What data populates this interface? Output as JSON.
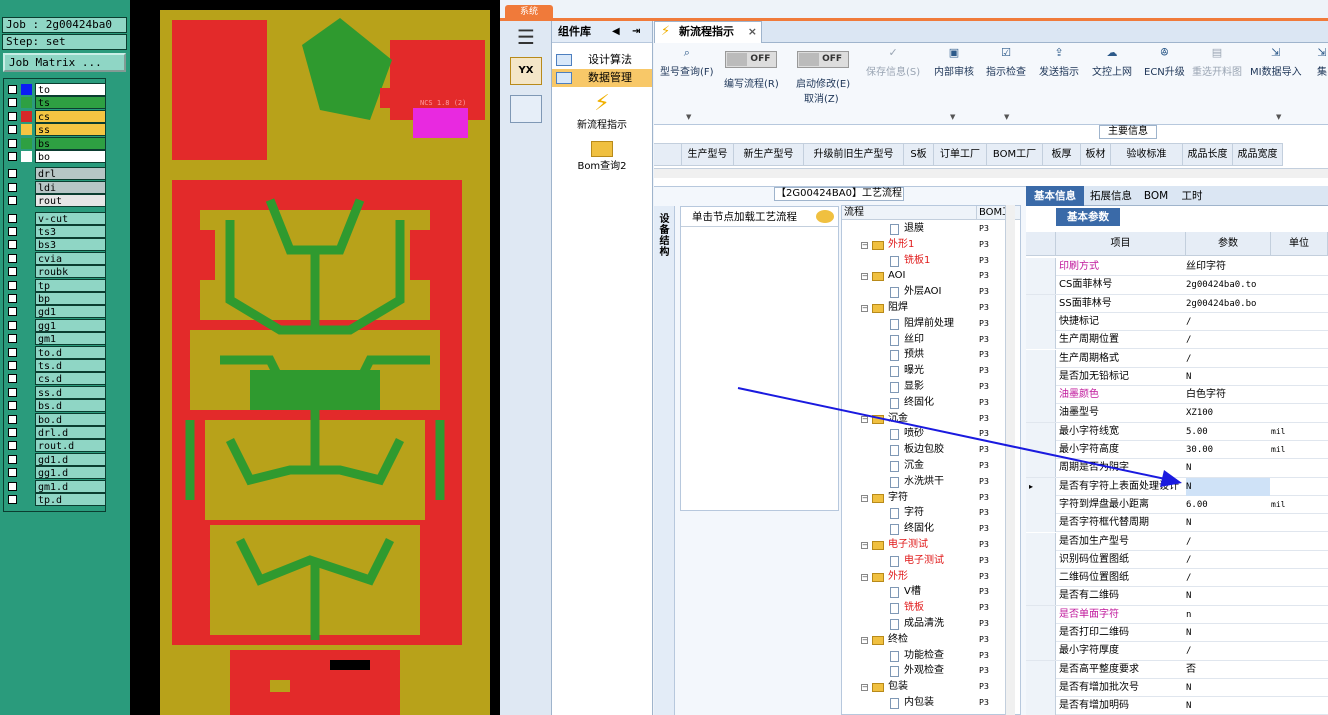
{
  "cad": {
    "job_line": "Job : 2g00424ba0",
    "step_line": "Step: set",
    "matrix_button": "Job Matrix ...",
    "layers": [
      {
        "name": "to",
        "color": "#0b1cf5",
        "type": "sig"
      },
      {
        "name": "ts",
        "color": "#2ea042",
        "type": "sig"
      },
      {
        "name": "cs",
        "color": "#d42828",
        "type": "sig"
      },
      {
        "name": "ss",
        "color": "#f4c542",
        "type": "sig"
      },
      {
        "name": "bs",
        "color": "#2ea042",
        "type": "sig"
      },
      {
        "name": "bo",
        "color": "#ffffff",
        "type": "sig"
      },
      {
        "name": "drl",
        "color": "",
        "type": "drill"
      },
      {
        "name": "ldi",
        "color": "",
        "type": "drill"
      },
      {
        "name": "rout",
        "color": "",
        "type": "drill"
      },
      {
        "name": "v-cut",
        "color": "",
        "type": "misc"
      },
      {
        "name": "ts3",
        "color": "",
        "type": "misc"
      },
      {
        "name": "bs3",
        "color": "",
        "type": "misc"
      },
      {
        "name": "cvia",
        "color": "",
        "type": "misc"
      },
      {
        "name": "roubk",
        "color": "",
        "type": "misc"
      },
      {
        "name": "tp",
        "color": "",
        "type": "misc"
      },
      {
        "name": "bp",
        "color": "",
        "type": "misc"
      },
      {
        "name": "gd1",
        "color": "",
        "type": "misc"
      },
      {
        "name": "gg1",
        "color": "",
        "type": "misc"
      },
      {
        "name": "gm1",
        "color": "",
        "type": "misc"
      },
      {
        "name": "to.d",
        "color": "",
        "type": "misc"
      },
      {
        "name": "ts.d",
        "color": "",
        "type": "misc"
      },
      {
        "name": "cs.d",
        "color": "",
        "type": "misc"
      },
      {
        "name": "ss.d",
        "color": "",
        "type": "misc"
      },
      {
        "name": "bs.d",
        "color": "",
        "type": "misc"
      },
      {
        "name": "bo.d",
        "color": "",
        "type": "misc"
      },
      {
        "name": "drl.d",
        "color": "",
        "type": "misc"
      },
      {
        "name": "rout.d",
        "color": "",
        "type": "misc"
      },
      {
        "name": "gd1.d",
        "color": "",
        "type": "misc"
      },
      {
        "name": "gg1.d",
        "color": "",
        "type": "misc"
      },
      {
        "name": "gm1.d",
        "color": "",
        "type": "misc"
      },
      {
        "name": "tp.d",
        "color": "",
        "type": "misc"
      }
    ],
    "pcb_colors": {
      "board": "#b8a21a",
      "copper": "#e32a2a",
      "trace": "#2f9a2f",
      "highlight": "#e829e0"
    },
    "pcb_label": "NCS 1.8 (2)"
  },
  "app": {
    "system_tab": "系统",
    "component_lib": {
      "title": "组件库",
      "items": [
        "设计算法",
        "数据管理"
      ],
      "tools": [
        "新流程指示",
        "Bom查询2"
      ]
    },
    "tab": {
      "label": "新流程指示",
      "close": "×"
    },
    "toolbar": {
      "query_label": "型号查询(F)",
      "edit_flow_label": "编写流程(R)",
      "edit_flow_state": "OFF",
      "auto_modify_label": "启动修改(E)",
      "auto_modify_state": "OFF",
      "cancel_label": "取消(Z)",
      "save_label": "保存信息(S)",
      "internal_audit_label": "内部审核",
      "check_label": "指示检查",
      "send_label": "发送指示",
      "upload_label": "文控上网",
      "ecn_label": "ECN升级",
      "reselect_label": "重选开料图",
      "mi_import_label": "MI数据导入",
      "more_label": "集"
    },
    "main_info": {
      "title": "主要信息",
      "columns": [
        "生产型号",
        "新生产型号",
        "升级前旧生产型号",
        "S板",
        "订单工厂",
        "BOM工厂",
        "板厚",
        "板材",
        "验收标准",
        "成品长度",
        "成品宽度"
      ]
    },
    "flow": {
      "title": "【2G00424BA0】工艺流程",
      "device_tab": "设备结构",
      "hint": "单击节点加载工艺流程",
      "col_flow": "流程",
      "col_bom": "BOM工",
      "rows": [
        {
          "label": "退膜",
          "level": 2,
          "kind": "doc",
          "red": false,
          "bom": "P3"
        },
        {
          "label": "外形1",
          "level": 1,
          "kind": "folder",
          "red": true,
          "bom": "P3"
        },
        {
          "label": "铣板1",
          "level": 2,
          "kind": "doc",
          "red": true,
          "bom": "P3"
        },
        {
          "label": "AOI",
          "level": 1,
          "kind": "folder",
          "red": false,
          "bom": "P3"
        },
        {
          "label": "外层AOI",
          "level": 2,
          "kind": "doc",
          "red": false,
          "bom": "P3"
        },
        {
          "label": "阻焊",
          "level": 1,
          "kind": "folder",
          "red": false,
          "bom": "P3"
        },
        {
          "label": "阻焊前处理",
          "level": 2,
          "kind": "doc",
          "red": false,
          "bom": "P3"
        },
        {
          "label": "丝印",
          "level": 2,
          "kind": "doc",
          "red": false,
          "bom": "P3"
        },
        {
          "label": "预烘",
          "level": 2,
          "kind": "doc",
          "red": false,
          "bom": "P3"
        },
        {
          "label": "曝光",
          "level": 2,
          "kind": "doc",
          "red": false,
          "bom": "P3"
        },
        {
          "label": "显影",
          "level": 2,
          "kind": "doc",
          "red": false,
          "bom": "P3"
        },
        {
          "label": "终固化",
          "level": 2,
          "kind": "doc",
          "red": false,
          "bom": "P3"
        },
        {
          "label": "沉金",
          "level": 1,
          "kind": "folder",
          "red": false,
          "bom": "P3"
        },
        {
          "label": "喷砂",
          "level": 2,
          "kind": "doc",
          "red": false,
          "bom": "P3"
        },
        {
          "label": "板边包胶",
          "level": 2,
          "kind": "doc",
          "red": false,
          "bom": "P3"
        },
        {
          "label": "沉金",
          "level": 2,
          "kind": "doc",
          "red": false,
          "bom": "P3"
        },
        {
          "label": "水洗烘干",
          "level": 2,
          "kind": "doc",
          "red": false,
          "bom": "P3"
        },
        {
          "label": "字符",
          "level": 1,
          "kind": "folder",
          "red": false,
          "bom": "P3"
        },
        {
          "label": "字符",
          "level": 2,
          "kind": "doc",
          "red": false,
          "bom": "P3"
        },
        {
          "label": "终固化",
          "level": 2,
          "kind": "doc",
          "red": false,
          "bom": "P3"
        },
        {
          "label": "电子测试",
          "level": 1,
          "kind": "folder",
          "red": true,
          "bom": "P3"
        },
        {
          "label": "电子测试",
          "level": 2,
          "kind": "doc",
          "red": true,
          "bom": "P3"
        },
        {
          "label": "外形",
          "level": 1,
          "kind": "folder",
          "red": true,
          "bom": "P3"
        },
        {
          "label": "V槽",
          "level": 2,
          "kind": "doc",
          "red": false,
          "bom": "P3"
        },
        {
          "label": "铣板",
          "level": 2,
          "kind": "doc",
          "red": true,
          "bom": "P3"
        },
        {
          "label": "成品清洗",
          "level": 2,
          "kind": "doc",
          "red": false,
          "bom": "P3"
        },
        {
          "label": "终检",
          "level": 1,
          "kind": "folder",
          "red": false,
          "bom": "P3"
        },
        {
          "label": "功能检查",
          "level": 2,
          "kind": "doc",
          "red": false,
          "bom": "P3"
        },
        {
          "label": "外观检查",
          "level": 2,
          "kind": "doc",
          "red": false,
          "bom": "P3"
        },
        {
          "label": "包装",
          "level": 1,
          "kind": "folder",
          "red": false,
          "bom": "P3"
        },
        {
          "label": "内包装",
          "level": 2,
          "kind": "doc",
          "red": false,
          "bom": "P3"
        }
      ]
    },
    "params": {
      "tabs": [
        "基本信息",
        "拓展信息",
        "BOM",
        "工时"
      ],
      "subtab": "基本参数",
      "headers": [
        "项目",
        "参数",
        "单位"
      ],
      "rows": [
        {
          "item": "印刷方式",
          "value": "丝印字符",
          "unit": "",
          "mag": true
        },
        {
          "item": "CS面菲林号",
          "value": "2g00424ba0.to",
          "unit": "",
          "mag": false
        },
        {
          "item": "SS面菲林号",
          "value": "2g00424ba0.bo",
          "unit": "",
          "mag": false
        },
        {
          "item": "快捷标记",
          "value": "/",
          "unit": "",
          "mag": false
        },
        {
          "item": "生产周期位置",
          "value": "/",
          "unit": "",
          "mag": false
        },
        {
          "item": "生产周期格式",
          "value": "/",
          "unit": "",
          "mag": false
        },
        {
          "item": "是否加无铅标记",
          "value": "N",
          "unit": "",
          "mag": false
        },
        {
          "item": "油墨颜色",
          "value": "白色字符",
          "unit": "",
          "mag": true
        },
        {
          "item": "油墨型号",
          "value": "XZ100",
          "unit": "",
          "mag": false
        },
        {
          "item": "最小字符线宽",
          "value": "5.00",
          "unit": "mil",
          "mag": false
        },
        {
          "item": "最小字符高度",
          "value": "30.00",
          "unit": "mil",
          "mag": false
        },
        {
          "item": "周期是否为阴字",
          "value": "N",
          "unit": "",
          "mag": false
        },
        {
          "item": "是否有字符上表面处理设计",
          "value": "N",
          "unit": "",
          "mag": false
        },
        {
          "item": "字符到焊盘最小距离",
          "value": "6.00",
          "unit": "mil",
          "mag": false
        },
        {
          "item": "是否字符框代替周期",
          "value": "N",
          "unit": "",
          "mag": false
        },
        {
          "item": "是否加生产型号",
          "value": "/",
          "unit": "",
          "mag": false
        },
        {
          "item": "识别码位置图纸",
          "value": "/",
          "unit": "",
          "mag": false
        },
        {
          "item": "二维码位置图纸",
          "value": "/",
          "unit": "",
          "mag": false
        },
        {
          "item": "是否有二维码",
          "value": "N",
          "unit": "",
          "mag": false
        },
        {
          "item": "是否单面字符",
          "value": "n",
          "unit": "",
          "mag": true
        },
        {
          "item": "是否打印二维码",
          "value": "N",
          "unit": "",
          "mag": false
        },
        {
          "item": "最小字符厚度",
          "value": "/",
          "unit": "",
          "mag": false
        },
        {
          "item": "是否高平整度要求",
          "value": "否",
          "unit": "",
          "mag": false
        },
        {
          "item": "是否有增加批次号",
          "value": "N",
          "unit": "",
          "mag": false
        },
        {
          "item": "是否有增加明码",
          "value": "N",
          "unit": "",
          "mag": false
        }
      ]
    }
  }
}
